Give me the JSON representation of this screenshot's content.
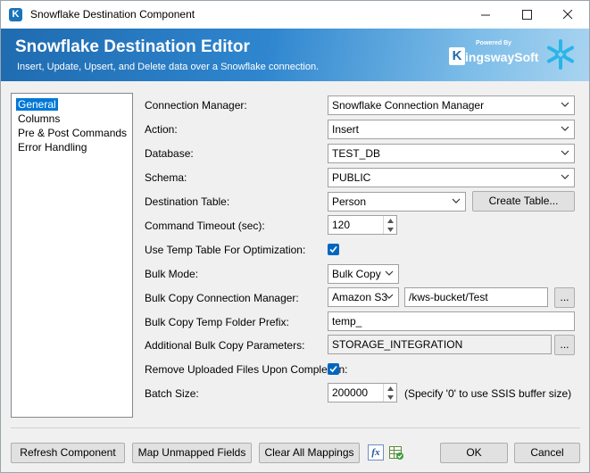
{
  "window": {
    "title": "Snowflake Destination Component",
    "minimize": "—",
    "maximize": "☐",
    "close": "✕"
  },
  "header": {
    "title": "Snowflake Destination Editor",
    "subtitle": "Insert, Update, Upsert, and Delete data over a Snowflake connection.",
    "brand_powered": "Powered By",
    "brand_k": "K",
    "brand_name": "ingswaySoft"
  },
  "tree": {
    "items": [
      {
        "label": "General",
        "selected": true
      },
      {
        "label": "Columns"
      },
      {
        "label": "Pre & Post Commands"
      },
      {
        "label": "Error Handling"
      }
    ]
  },
  "form": {
    "connection_manager": {
      "label": "Connection Manager:",
      "value": "Snowflake Connection Manager"
    },
    "action": {
      "label": "Action:",
      "value": "Insert"
    },
    "database": {
      "label": "Database:",
      "value": "TEST_DB"
    },
    "schema": {
      "label": "Schema:",
      "value": "PUBLIC"
    },
    "destination_table": {
      "label": "Destination Table:",
      "value": "Person",
      "button": "Create Table..."
    },
    "command_timeout": {
      "label": "Command Timeout (sec):",
      "value": "120"
    },
    "use_temp_table": {
      "label": "Use Temp Table For Optimization:",
      "checked": true
    },
    "bulk_mode": {
      "label": "Bulk Mode:",
      "value": "Bulk Copy"
    },
    "bulk_copy_connection": {
      "label": "Bulk Copy Connection Manager:",
      "value": "Amazon S3",
      "path": "/kws-bucket/Test",
      "browse": "..."
    },
    "bulk_copy_temp_prefix": {
      "label": "Bulk Copy Temp Folder Prefix:",
      "value": "temp_"
    },
    "additional_params": {
      "label": "Additional Bulk Copy Parameters:",
      "value": "STORAGE_INTEGRATION",
      "browse": "..."
    },
    "remove_uploaded": {
      "label": "Remove Uploaded Files Upon Completion:",
      "checked": true
    },
    "batch_size": {
      "label": "Batch Size:",
      "value": "200000",
      "note": "(Specify '0' to use SSIS buffer size)"
    }
  },
  "footer": {
    "refresh": "Refresh Component",
    "map_unmapped": "Map Unmapped Fields",
    "clear_mappings": "Clear All Mappings",
    "fx_icon": "fx",
    "ok": "OK",
    "cancel": "Cancel"
  },
  "colors": {
    "accent": "#0067c0",
    "header_start": "#1f6bb0",
    "header_end": "#a9d4f1",
    "snowflake": "#29b5e8",
    "selection": "#0078d7"
  }
}
